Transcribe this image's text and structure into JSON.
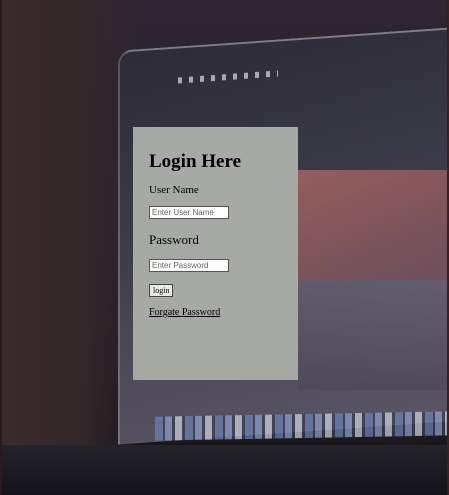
{
  "login": {
    "title": "Login Here",
    "username_label": "User Name",
    "username_value": "",
    "username_placeholder": "Enter User Name",
    "password_label": "Password",
    "password_value": "",
    "password_placeholder": "Enter Password",
    "login_button": "login",
    "forgot_link": "Forgate Password"
  },
  "colors": {
    "panel_background": "#a6a9a4",
    "page_background": "#2a2226"
  },
  "background": {
    "type": "blurred photo of a laptop"
  }
}
